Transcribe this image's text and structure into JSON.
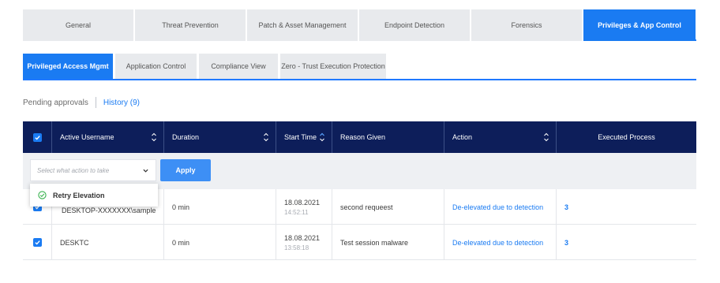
{
  "top_tabs": [
    {
      "label": "General"
    },
    {
      "label": "Threat Prevention"
    },
    {
      "label": "Patch & Asset Management"
    },
    {
      "label": "Endpoint Detection"
    },
    {
      "label": "Forensics"
    },
    {
      "label": "Privileges & App Control"
    }
  ],
  "sub_tabs": [
    {
      "label": "Privileged Access Mgmt"
    },
    {
      "label": "Application Control"
    },
    {
      "label": "Compliance View"
    },
    {
      "label": "Zero - Trust Execution Protection"
    }
  ],
  "filters": {
    "pending": "Pending approvals",
    "history": "History (9)"
  },
  "table": {
    "columns": [
      "Active Username",
      "Duration",
      "Start Time",
      "Reason Given",
      "Action",
      "Executed Process"
    ],
    "action_select_placeholder": "Select what action to take",
    "apply_label": "Apply",
    "popup_option": "Retry Elevation",
    "rows": [
      {
        "username": "DESKTOP-XXXXXXX\\sample",
        "duration": "0 min",
        "date": "18.08.2021",
        "time": "14:52:11",
        "reason": "second requeest",
        "action": "De-elevated due to detection",
        "process": "3"
      },
      {
        "username": "DESKTC",
        "duration": "0 min",
        "date": "18.08.2021",
        "time": "13:58:18",
        "reason": "Test session malware",
        "action": "De-elevated due to detection",
        "process": "3"
      }
    ]
  },
  "colors": {
    "accent": "#1a7bf2",
    "header_bg": "#0d1e5a",
    "tab_bg": "#e8eaed"
  }
}
